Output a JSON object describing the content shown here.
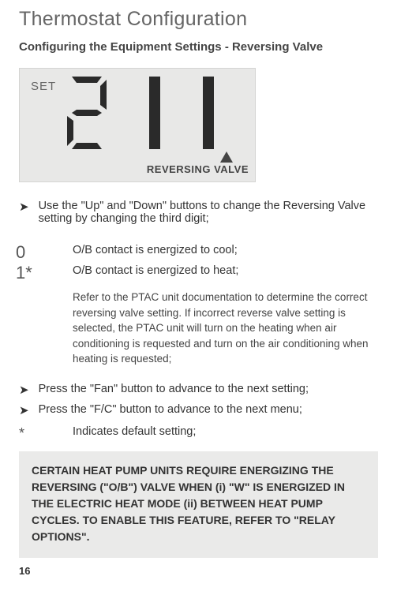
{
  "title": "Thermostat Configuration",
  "subtitle": "Configuring the Equipment Settings - Reversing Valve",
  "lcd": {
    "set_label": "SET",
    "digits": "211",
    "bottom_label": "REVERSING VALVE"
  },
  "step1": "Use the \"Up\" and \"Down\" buttons to change the Reversing Valve setting by changing the third digit;",
  "options": [
    {
      "key": "0",
      "desc": "O/B contact is energized to cool;"
    },
    {
      "key": "1*",
      "desc": "O/B contact is energized to heat;"
    }
  ],
  "note": "Refer to the PTAC unit documentation to determine the correct reversing valve setting. If incorrect reverse valve setting is selected, the PTAC unit will turn on the heating when air conditioning is requested and turn on the air conditioning when heating is requested;",
  "step2": "Press the \"Fan\" button to advance to the next setting;",
  "step3": "Press the \"F/C\" button to advance to the next menu;",
  "default_note": "Indicates default setting;",
  "callout": "CERTAIN HEAT PUMP UNITS REQUIRE ENERGIZING THE REVERSING (\"O/B\") VALVE WHEN (i) \"W\" IS ENERGIZED IN THE ELECTRIC HEAT MODE (ii) BETWEEN HEAT PUMP CYCLES. TO ENABLE THIS FEATURE, REFER TO \"RELAY OPTIONS\".",
  "page_number": "16",
  "glyphs": {
    "arrow_bullet": "➤",
    "up_arrow": "🞁"
  }
}
